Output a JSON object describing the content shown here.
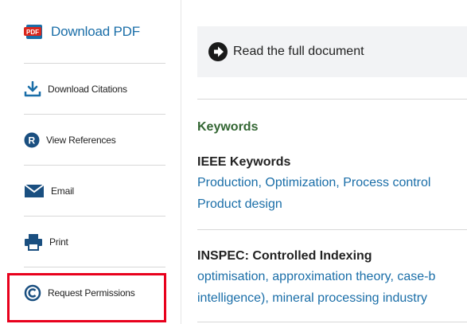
{
  "sidebar": {
    "download_pdf": {
      "label": "Download PDF",
      "icon": "pdf-icon"
    },
    "download_citations": {
      "label": "Download Citations",
      "icon": "download-icon"
    },
    "view_references": {
      "label": "View References",
      "icon": "references-icon"
    },
    "email": {
      "label": "Email",
      "icon": "email-icon"
    },
    "print": {
      "label": "Print",
      "icon": "print-icon"
    },
    "request_permissions": {
      "label": "Request Permissions",
      "icon": "copyright-icon"
    }
  },
  "main": {
    "read_full": {
      "label": "Read the full document",
      "icon": "arrow-right-circle-icon"
    },
    "keywords_title": "Keywords",
    "ieee": {
      "title": "IEEE Keywords",
      "line1": "Production, Optimization, Process control",
      "line2": "Product design"
    },
    "inspec": {
      "title": "INSPEC: Controlled Indexing",
      "line1": "optimisation, approximation theory, case-b",
      "line2": "intelligence), mineral processing industry"
    }
  },
  "colors": {
    "link": "#1a6ea8",
    "keywords_green": "#336633",
    "highlight_red": "#e8001c"
  }
}
